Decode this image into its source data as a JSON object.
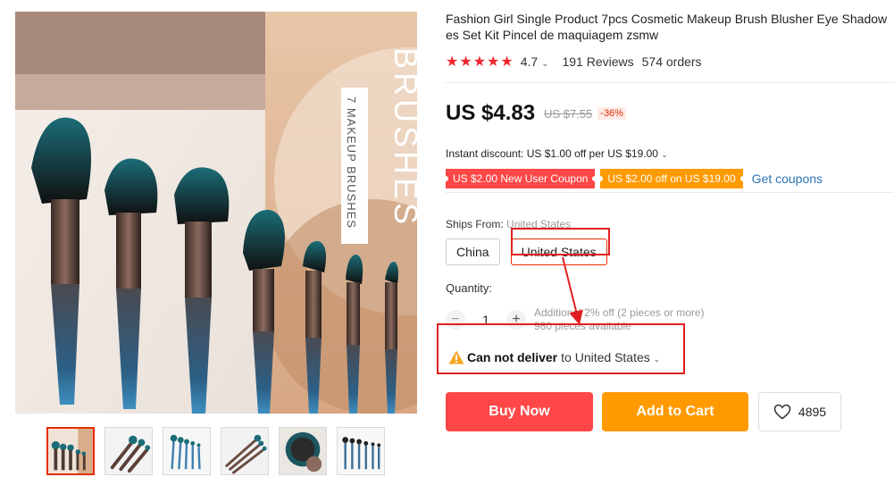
{
  "product": {
    "title_line1": "Fashion Girl Single Product 7pcs Cosmetic Makeup Brush Blusher Eye Shadow",
    "title_line2": "es Set Kit Pincel de maquiagem zsmw",
    "rating": "4.7",
    "stars": "★★★★★",
    "reviews": "191 Reviews",
    "orders": "574 orders"
  },
  "image": {
    "banner_big": "BRUSHES",
    "banner_small": "7 MAKEUP BRUSHES",
    "thumbnail_count": 6
  },
  "pricing": {
    "price": "US $4.83",
    "original_price": "US $7.55",
    "discount": "-36%",
    "instant_discount": "Instant discount: US $1.00 off per US $19.00"
  },
  "coupons": {
    "coupon1": "US $2.00 New User Coupon",
    "coupon2": "US $2.00 off on US $19.00",
    "get_coupons": "Get coupons"
  },
  "shipping": {
    "label": "Ships From:",
    "selected": "United States",
    "options": [
      "China",
      "United States"
    ]
  },
  "quantity": {
    "label": "Quantity:",
    "value": "1",
    "minus": "−",
    "plus": "+",
    "note_line1": "Additional 2% off (2 pieces or more)",
    "note_line2": "980 pieces available"
  },
  "delivery": {
    "status": "Can not deliver",
    "destination": "to United States"
  },
  "actions": {
    "buy_now": "Buy Now",
    "add_to_cart": "Add to Cart",
    "wishlist_count": "4895"
  },
  "icons": {
    "warning": "warning-icon",
    "heart": "heart-icon",
    "chevron": "chevron-down-icon"
  },
  "colors": {
    "accent_red": "#ff4747",
    "accent_orange": "#ff9a00",
    "link_blue": "#2e74b5",
    "annotation_red": "#e02020"
  }
}
